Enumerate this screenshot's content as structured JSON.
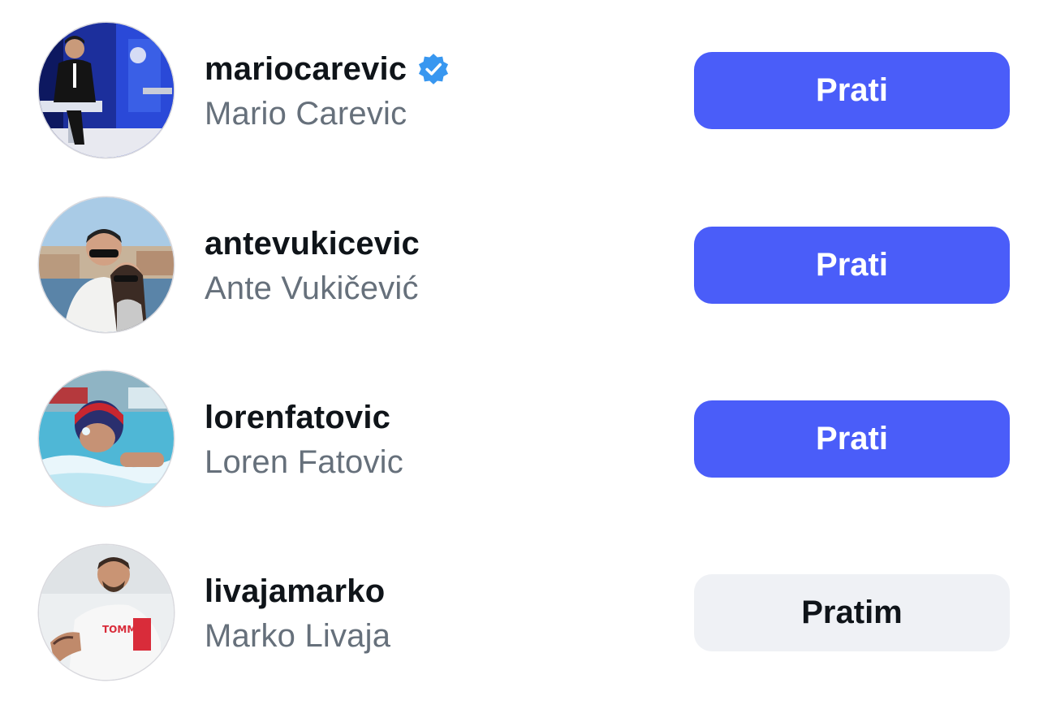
{
  "accounts": [
    {
      "username": "mariocarevic",
      "full_name": "Mario Carevic",
      "verified": true,
      "button_label": "Prati",
      "button_state": "follow"
    },
    {
      "username": "antevukicevic",
      "full_name": "Ante Vukičević",
      "verified": false,
      "button_label": "Prati",
      "button_state": "follow"
    },
    {
      "username": "lorenfatovic",
      "full_name": "Loren Fatovic",
      "verified": false,
      "button_label": "Prati",
      "button_state": "follow"
    },
    {
      "username": "livajamarko",
      "full_name": "Marko Livaja",
      "verified": false,
      "button_label": "Pratim",
      "button_state": "following"
    }
  ],
  "colors": {
    "follow_button": "#4a5df9",
    "following_button": "#eff1f5",
    "verified_badge": "#3897f0",
    "username_text": "#0f1419",
    "full_name_text": "#66707b"
  }
}
